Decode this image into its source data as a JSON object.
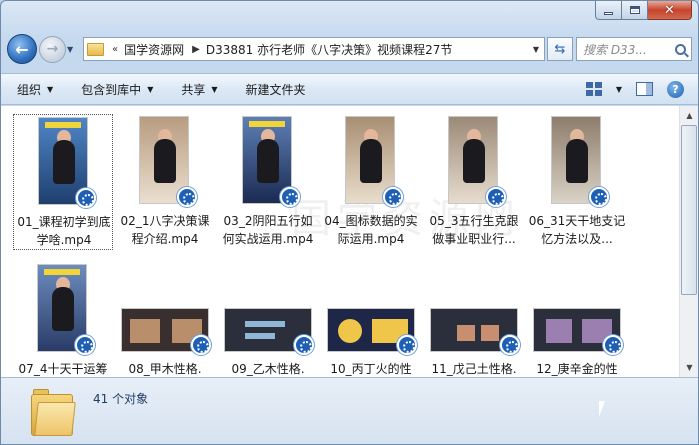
{
  "address": {
    "overflow_glyph": "«",
    "crumbs": [
      "国学资源网",
      "D33881 亦行老师《八字决策》视频课程27节"
    ]
  },
  "search": {
    "placeholder": "搜索 D33..."
  },
  "toolbar": {
    "organize": "组织",
    "include_in_library": "包含到库中",
    "share": "共享",
    "new_folder": "新建文件夹"
  },
  "files": [
    {
      "name": "01_课程初学到底学啥.mp4",
      "type": "portrait",
      "colors": [
        "#1f3f6e",
        "#4f86c6"
      ]
    },
    {
      "name": "02_1八字决策课程介绍.mp4",
      "type": "portrait",
      "colors": [
        "#eadfcf",
        "#b89c80"
      ]
    },
    {
      "name": "03_2阴阳五行如何实战运用.mp4",
      "type": "portrait",
      "colors": [
        "#1b2b52",
        "#5d7fb5"
      ]
    },
    {
      "name": "04_图标数据的实际运用.mp4",
      "type": "portrait",
      "colors": [
        "#e8ddcc",
        "#a88f72"
      ]
    },
    {
      "name": "05_3五行生克跟做事业职业行...",
      "type": "portrait",
      "colors": [
        "#e6dccd",
        "#9c8a78"
      ]
    },
    {
      "name": "06_31天干地支记忆方法以及...",
      "type": "portrait",
      "colors": [
        "#d9d2c6",
        "#8e7d6c"
      ]
    },
    {
      "name": "07_4十天干运筹",
      "type": "portrait",
      "colors": [
        "#2a3c66",
        "#6c8cbf"
      ]
    },
    {
      "name": "08_甲木性格.",
      "type": "wide",
      "colors": [
        "#3a2f2f",
        "#b98e6a"
      ]
    },
    {
      "name": "09_乙木性格.",
      "type": "wide",
      "colors": [
        "#2b2f3c",
        "#8fb6d6"
      ]
    },
    {
      "name": "10_丙丁火的性",
      "type": "wide",
      "colors": [
        "#1f2748",
        "#f0c64a"
      ]
    },
    {
      "name": "11_戊己土性格.",
      "type": "wide",
      "colors": [
        "#2b2f3c",
        "#c78f6f"
      ]
    },
    {
      "name": "12_庚辛金的性",
      "type": "wide",
      "colors": [
        "#2b2f3c",
        "#9a7fb0"
      ]
    }
  ],
  "status": {
    "item_count": "41 个对象"
  },
  "watermark": "国学资源网"
}
